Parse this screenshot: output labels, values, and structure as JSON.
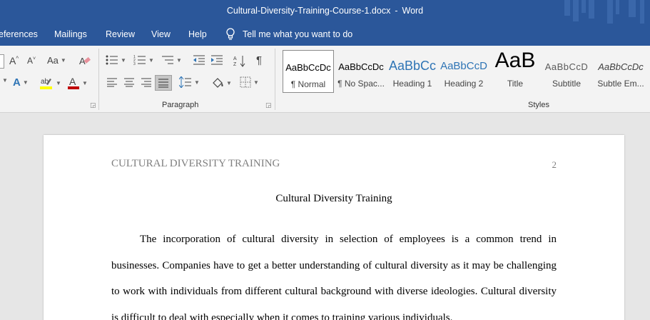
{
  "window": {
    "filename": "Cultural-Diversity-Training-Course-1.docx",
    "separator": "-",
    "app_name": "Word"
  },
  "menu": {
    "items": [
      "eferences",
      "Mailings",
      "Review",
      "View",
      "Help"
    ],
    "tell_me": "Tell me what you want to do"
  },
  "ribbon": {
    "font_icons": [
      "grow-font-icon",
      "shrink-font-icon",
      "change-case-icon",
      "clear-formatting-icon",
      "text-effects-icon",
      "highlight-icon",
      "font-color-icon"
    ],
    "paragraph_label": "Paragraph",
    "styles_label": "Styles",
    "highlight_color": "#ffff00",
    "font_color": "#c00000",
    "styles": [
      {
        "preview": "AaBbCcDc",
        "name": "¶ Normal"
      },
      {
        "preview": "AaBbCcDc",
        "name": "¶ No Spac..."
      },
      {
        "preview": "AaBbCc",
        "name": "Heading 1"
      },
      {
        "preview": "AaBbCcD",
        "name": "Heading 2"
      },
      {
        "preview": "AaB",
        "name": "Title"
      },
      {
        "preview": "AaBbCcD",
        "name": "Subtitle"
      },
      {
        "preview": "AaBbCcDc",
        "name": "Subtle Em..."
      }
    ],
    "heading_color": "#2e74b5",
    "accent": "#2b579a"
  },
  "document": {
    "header": "CULTURAL DIVERSITY TRAINING",
    "page_number": "2",
    "title": "Cultural Diversity Training",
    "paragraph": "The incorporation of cultural diversity in selection of employees is a common trend in businesses. Companies have to get a better understanding of cultural diversity as it may be challenging to work with individuals from different cultural background with diverse ideologies. Cultural diversity is difficult to deal with especially when it comes to training various individuals."
  }
}
